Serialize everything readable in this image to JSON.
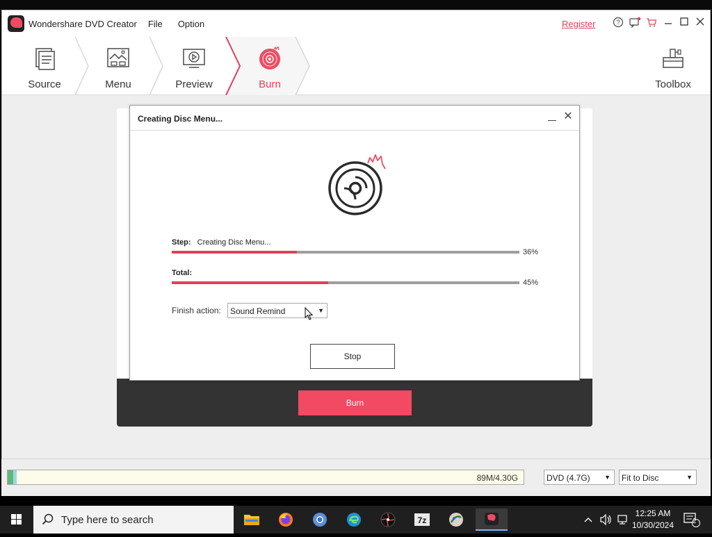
{
  "app": {
    "title": "Wondershare DVD Creator",
    "menu": [
      "File",
      "Option"
    ],
    "register_label": "Register",
    "title_icons": [
      "help-icon",
      "feedback-icon",
      "cart-icon",
      "minimize-icon",
      "maximize-icon",
      "close-icon"
    ]
  },
  "steps": [
    {
      "label": "Source",
      "icon": "source-doc-icon",
      "active": false
    },
    {
      "label": "Menu",
      "icon": "menu-image-icon",
      "active": false
    },
    {
      "label": "Preview",
      "icon": "preview-play-icon",
      "active": false
    },
    {
      "label": "Burn",
      "icon": "burn-disc-icon",
      "active": true
    }
  ],
  "toolbox": {
    "label": "Toolbox",
    "icon": "toolbox-icon"
  },
  "dialog": {
    "title": "Creating Disc Menu...",
    "step_label": "Step:",
    "step_text": "Creating Disc Menu...",
    "step_progress": 0.36,
    "step_percent": "36%",
    "total_label": "Total:",
    "total_progress": 0.45,
    "total_percent": "45%",
    "finish_action_label": "Finish action:",
    "finish_action_value": "Sound Remind",
    "stop_label": "Stop"
  },
  "burn_button": "Burn",
  "bottom": {
    "capacity_text": "89M/4.30G",
    "capacity_fraction": 0.02,
    "disc_type": "DVD (4.7G)",
    "fit_mode": "Fit to Disc"
  },
  "taskbar": {
    "search_placeholder": "Type here to search",
    "apps": [
      "file-explorer-icon",
      "firefox-icon",
      "chromium-icon",
      "edge-icon",
      "davinci-icon",
      "7zip-icon",
      "ai-app-icon",
      "dvd-creator-icon"
    ],
    "time": "12:25 AM",
    "date": "10/30/2024",
    "notification_count": "2"
  },
  "colors": {
    "accent": "#e0405a",
    "burn_button": "#f14a62",
    "progress_track": "#9e9e9e"
  }
}
